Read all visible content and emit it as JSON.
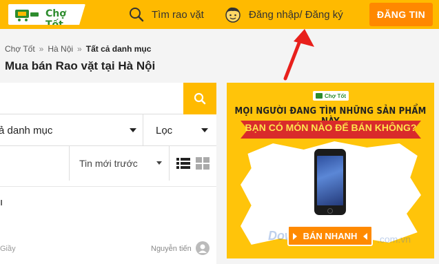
{
  "header": {
    "logo_text": "Chợ Tốt",
    "search_label": "Tìm rao vặt",
    "login_label": "Đăng nhập/ Đăng ký",
    "post_button": "ĐĂNG TIN"
  },
  "breadcrumb": {
    "items": [
      "Chợ Tốt",
      "Hà Nội",
      "Tất cả danh mục"
    ],
    "separator": "»"
  },
  "page_title": "Mua bán Rao vặt tại Hà Nội",
  "filters": {
    "category": "ả danh mục",
    "filter": "Lọc",
    "sort": "Tin mới trước"
  },
  "listing": {
    "title_fragment": "ı",
    "category_fragment": "Giầy",
    "user": "Nguyễn tiến"
  },
  "ad": {
    "logo_text": "Chợ Tốt",
    "line1": "MỌI NGƯỜI ĐANG TÌM NHỮNG SẢN PHẨM NÀY",
    "line2": "BẠN CÓ MÓN NÀO ĐỂ BÁN KHÔNG?",
    "button": "BÁN NHANH",
    "watermark1": "Down",
    "watermark2": ".com.vn"
  },
  "colors": {
    "brand_yellow": "#ffba00",
    "post_orange": "#ff8800",
    "annotation_red": "#e8201c"
  },
  "icons": [
    "search-icon",
    "user-face-icon",
    "chevron-down-icon",
    "list-view-icon",
    "grid-view-icon",
    "avatar-icon",
    "arrow-annotation"
  ]
}
